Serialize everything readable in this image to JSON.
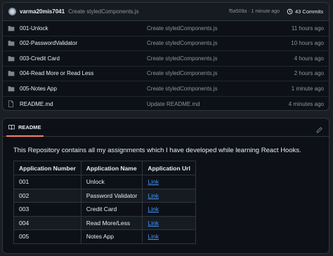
{
  "commit_bar": {
    "author": "varma20mis7041",
    "message": "Create styledComponents.js",
    "meta": "f5a509a · 1 minute ago",
    "commits_label": "43 Commits"
  },
  "files": [
    {
      "type": "folder",
      "name": "001-Unlock",
      "commit": "Create styledComponents.js",
      "time": "11 hours ago"
    },
    {
      "type": "folder",
      "name": "002-PasswordValidator",
      "commit": "Create styledComponents.js",
      "time": "10 hours ago"
    },
    {
      "type": "folder",
      "name": "003-Credit Card",
      "commit": "Create styledComponents.js",
      "time": "4 hours ago"
    },
    {
      "type": "folder",
      "name": "004-Read More or Read Less",
      "commit": "Create styledComponents.js",
      "time": "2 hours ago"
    },
    {
      "type": "folder",
      "name": "005-Notes App",
      "commit": "Create styledComponents.js",
      "time": "1 minute ago"
    },
    {
      "type": "file",
      "name": "README.md",
      "commit": "Update README.md",
      "time": "4 minutes ago"
    }
  ],
  "readme": {
    "tab_label": "README",
    "intro": "This Repository contains all my assignments which I have developed while learning React Hooks.",
    "table": {
      "headers": [
        "Application Number",
        "Application Name",
        "Application Url"
      ],
      "rows": [
        [
          "001",
          "Unlock",
          "Link"
        ],
        [
          "002",
          "Password Validator",
          "Link"
        ],
        [
          "003",
          "Credit Card",
          "Link"
        ],
        [
          "004",
          "Read More/Less",
          "Link"
        ],
        [
          "005",
          "Notes App",
          "Link"
        ]
      ]
    }
  },
  "colors": {
    "link": "#4493f8",
    "tab_underline": "#f78166",
    "folder_icon": "#7d8590"
  },
  "icons": {
    "folder": "folder-icon",
    "file": "file-icon",
    "book": "book-icon",
    "pencil": "pencil-icon",
    "history": "history-icon"
  }
}
